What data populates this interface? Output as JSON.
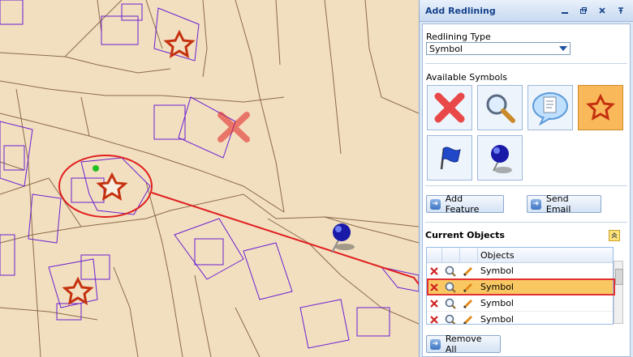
{
  "panel": {
    "title": "Add Redlining",
    "controls": [
      "minimize-icon",
      "restore-icon",
      "close-icon",
      "pin-icon"
    ],
    "redlining_type_label": "Redlining Type",
    "redlining_type_value": "Symbol",
    "available_symbols_label": "Available Symbols",
    "symbols": [
      {
        "icon": "red-x-icon",
        "selected": false
      },
      {
        "icon": "magnifier-icon",
        "selected": false
      },
      {
        "icon": "speech-bubble-document-icon",
        "selected": false
      },
      {
        "icon": "star-icon",
        "selected": true
      },
      {
        "icon": "blue-flag-icon",
        "selected": false
      },
      {
        "icon": "pushpin-icon",
        "selected": false
      }
    ],
    "add_feature_label": "Add Feature",
    "send_email_label": "Send Email",
    "current_objects_label": "Current Objects",
    "objects_header": "Objects",
    "objects": [
      {
        "label": "Symbol",
        "selected": false
      },
      {
        "label": "Symbol",
        "selected": true
      },
      {
        "label": "Symbol",
        "selected": false
      },
      {
        "label": "Symbol",
        "selected": false
      }
    ],
    "remove_all_label": "Remove All"
  },
  "colors": {
    "map_background": "#f2dfc0",
    "parcel_lines": "#8a6a4a",
    "building_outlines": "#6b1fd1",
    "annotation_red": "#e02020",
    "selected_highlight": "#f9c863"
  }
}
